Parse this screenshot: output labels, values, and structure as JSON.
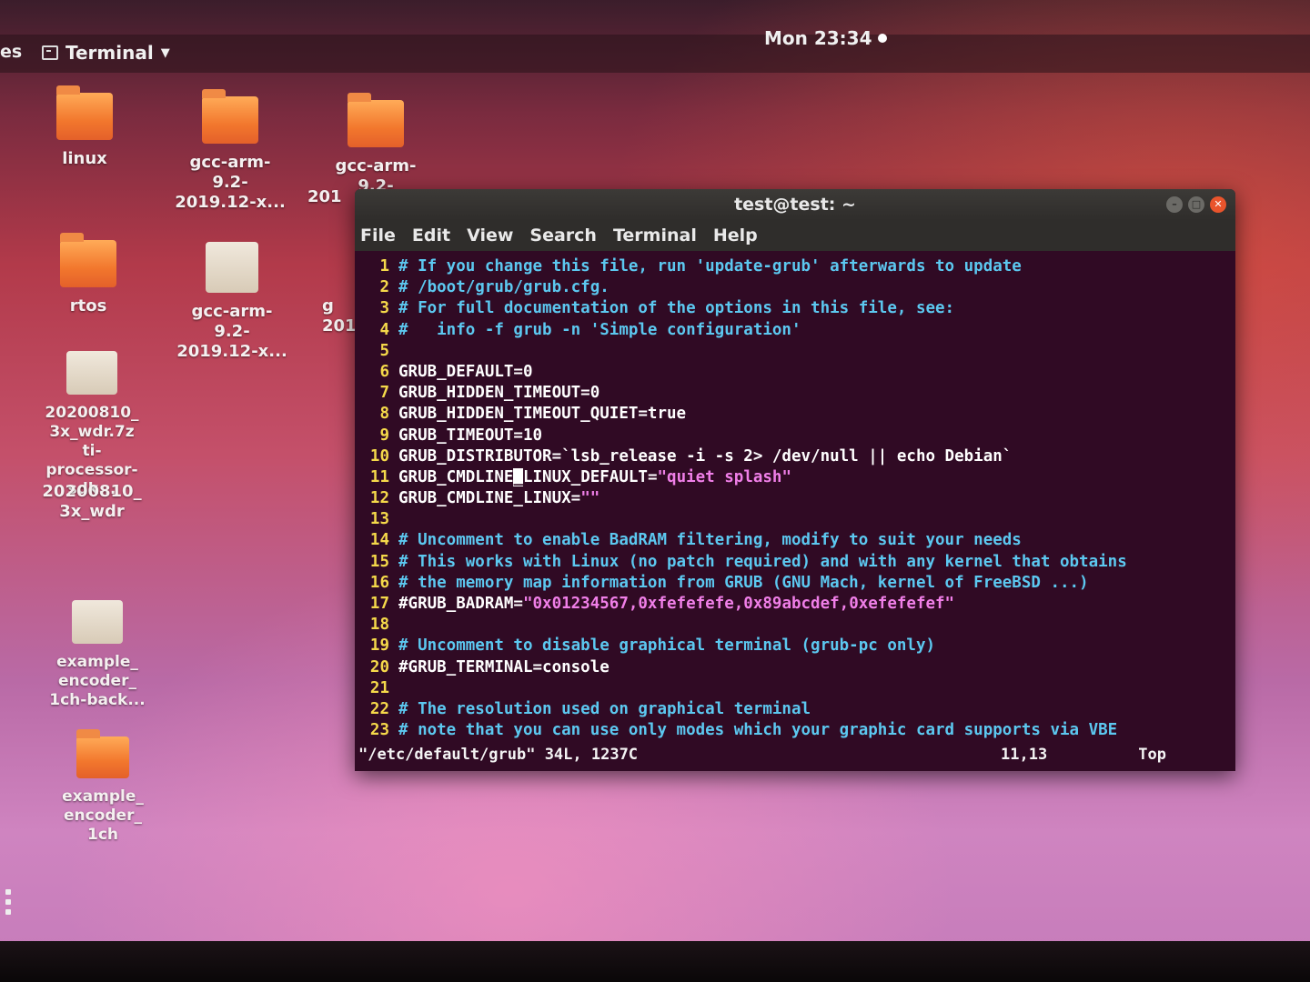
{
  "topbar": {
    "activities": "es",
    "app_menu_label": "Terminal",
    "clock": "Mon 23:34"
  },
  "desktop_icons": [
    {
      "label": "linux",
      "kind": "folder"
    },
    {
      "label": "gcc-arm-\n9.2-\n2019.12-x...",
      "kind": "folder"
    },
    {
      "label": "gcc-arm-\n9.2-",
      "kind": "folder"
    },
    {
      "label": "rtos",
      "kind": "folder"
    },
    {
      "label": "gcc-arm-\n9.2-\n2019.12-x...",
      "kind": "archive"
    },
    {
      "label": "g\n201",
      "kind": "folder"
    },
    {
      "label": "20200810_\n3x_wdr.7z\nti-\nprocessor-\nsdk...",
      "kind": "archive"
    },
    {
      "label": "20200810_\n3x_wdr",
      "kind": "folder"
    },
    {
      "label": "example_\nencoder_\n1ch-back...",
      "kind": "archive"
    },
    {
      "label": "example_\nencoder_\n1ch",
      "kind": "folder"
    },
    {
      "label": "201",
      "kind": "label"
    }
  ],
  "terminal": {
    "title": "test@test: ~",
    "menu": [
      "File",
      "Edit",
      "View",
      "Search",
      "Terminal",
      "Help"
    ],
    "lines": [
      {
        "n": "1",
        "text": "# If you change this file, run 'update-grub' afterwards to update",
        "type": "comment"
      },
      {
        "n": "2",
        "text": "# /boot/grub/grub.cfg.",
        "type": "comment"
      },
      {
        "n": "3",
        "text": "# For full documentation of the options in this file, see:",
        "type": "comment"
      },
      {
        "n": "4",
        "text": "#   info -f grub -n 'Simple configuration'",
        "type": "comment"
      },
      {
        "n": "5",
        "text": "",
        "type": "plain"
      },
      {
        "n": "6",
        "text": "GRUB_DEFAULT=0",
        "type": "plain"
      },
      {
        "n": "7",
        "text": "GRUB_HIDDEN_TIMEOUT=0",
        "type": "plain"
      },
      {
        "n": "8",
        "text": "GRUB_HIDDEN_TIMEOUT_QUIET=true",
        "type": "plain"
      },
      {
        "n": "9",
        "text": "GRUB_TIMEOUT=10",
        "type": "plain"
      },
      {
        "n": "10",
        "text": "GRUB_DISTRIBUTOR=`lsb_release -i -s 2> /dev/null || echo Debian`",
        "type": "plain"
      },
      {
        "n": "11",
        "key": "GRUB_CMDLINE",
        "cursor": "_",
        "rest": "LINUX_DEFAULT=",
        "value": "\"quiet splash\"",
        "type": "cursorline"
      },
      {
        "n": "12",
        "key": "GRUB_CMDLINE_LINUX=",
        "value": "\"\"",
        "type": "assign"
      },
      {
        "n": "13",
        "text": "",
        "type": "plain"
      },
      {
        "n": "14",
        "text": "# Uncomment to enable BadRAM filtering, modify to suit your needs",
        "type": "comment"
      },
      {
        "n": "15",
        "text": "# This works with Linux (no patch required) and with any kernel that obtains",
        "type": "comment"
      },
      {
        "n": "16",
        "text": "# the memory map information from GRUB (GNU Mach, kernel of FreeBSD ...)",
        "type": "comment"
      },
      {
        "n": "17",
        "key": "#GRUB_BADRAM=",
        "value": "\"0x01234567,0xfefefefe,0x89abcdef,0xefefefef\"",
        "type": "assign"
      },
      {
        "n": "18",
        "text": "",
        "type": "plain"
      },
      {
        "n": "19",
        "text": "# Uncomment to disable graphical terminal (grub-pc only)",
        "type": "comment"
      },
      {
        "n": "20",
        "text": "#GRUB_TERMINAL=console",
        "type": "plain"
      },
      {
        "n": "21",
        "text": "",
        "type": "plain"
      },
      {
        "n": "22",
        "text": "# The resolution used on graphical terminal",
        "type": "comment"
      },
      {
        "n": "23",
        "text": "# note that you can use only modes which your graphic card supports via VBE",
        "type": "comment"
      }
    ],
    "status": {
      "file": "\"/etc/default/grub\" 34L, 1237C",
      "position": "11,13",
      "scroll": "Top"
    }
  }
}
